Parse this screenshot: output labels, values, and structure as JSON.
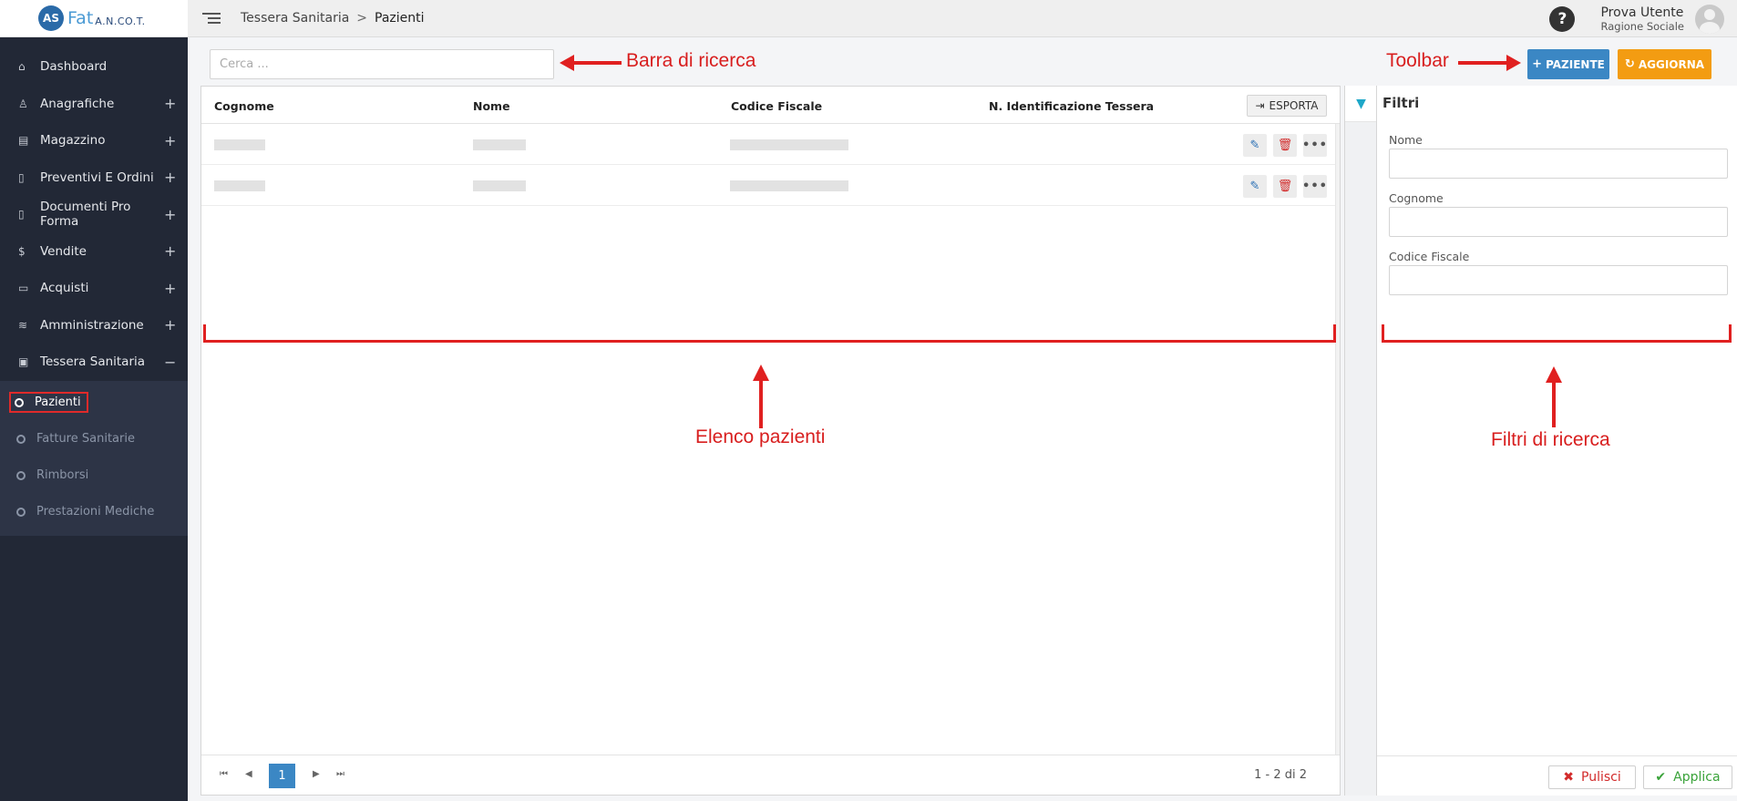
{
  "app": {
    "logo_mark": "AS",
    "logo_text": "Fat",
    "logo_sub": "A.N.CO.T."
  },
  "sidebar": {
    "items": [
      {
        "label": "Dashboard",
        "icon": "home-icon",
        "glyph": "⌂",
        "expand": ""
      },
      {
        "label": "Anagrafiche",
        "icon": "user-icon",
        "glyph": "♙",
        "expand": "+"
      },
      {
        "label": "Magazzino",
        "icon": "list-icon",
        "glyph": "▤",
        "expand": "+"
      },
      {
        "label": "Preventivi E Ordini",
        "icon": "document-icon",
        "glyph": "▯",
        "expand": "+"
      },
      {
        "label": "Documenti Pro Forma",
        "icon": "file-icon",
        "glyph": "▯",
        "expand": "+"
      },
      {
        "label": "Vendite",
        "icon": "dollar-icon",
        "glyph": "$",
        "expand": "+"
      },
      {
        "label": "Acquisti",
        "icon": "credit-card-icon",
        "glyph": "▭",
        "expand": "+"
      },
      {
        "label": "Amministrazione",
        "icon": "database-icon",
        "glyph": "≋",
        "expand": "+"
      },
      {
        "label": "Tessera Sanitaria",
        "icon": "medical-case-icon",
        "glyph": "▣",
        "expand": "−"
      }
    ],
    "subitems": [
      {
        "label": "Pazienti"
      },
      {
        "label": "Fatture Sanitarie"
      },
      {
        "label": "Rimborsi"
      },
      {
        "label": "Prestazioni Mediche"
      }
    ]
  },
  "header": {
    "breadcrumb_parent": "Tessera Sanitaria",
    "breadcrumb_sep": ">",
    "breadcrumb_current": "Pazienti",
    "help": "?",
    "user_name": "Prova Utente",
    "user_company": "Ragione Sociale"
  },
  "search": {
    "placeholder": "Cerca ...",
    "value": ""
  },
  "toolbar": {
    "add_label": "PAZIENTE",
    "add_icon": "+",
    "refresh_label": "AGGIORNA",
    "refresh_icon": "↻"
  },
  "table": {
    "columns": [
      "Cognome",
      "Nome",
      "Codice Fiscale",
      "N. Identificazione Tessera"
    ],
    "export_label": "ESPORTA",
    "export_icon": "⇥",
    "row_action_edit": "✎",
    "row_action_delete": "🗑",
    "row_action_more": "•••",
    "rows": [
      {},
      {}
    ]
  },
  "pagination": {
    "first": "⏮",
    "prev": "◀",
    "current": "1",
    "next": "▶",
    "last": "⏭",
    "info": "1 - 2 di 2"
  },
  "filters": {
    "tab_icon": "▼",
    "title": "Filtri",
    "fields": [
      {
        "label": "Nome",
        "value": ""
      },
      {
        "label": "Cognome",
        "value": ""
      },
      {
        "label": "Codice Fiscale",
        "value": ""
      }
    ],
    "clear_label": "Pulisci",
    "clear_icon": "✖",
    "apply_label": "Applica",
    "apply_icon": "✔"
  },
  "annotations": {
    "search_bar": "Barra di ricerca",
    "toolbar": "Toolbar",
    "patient_list": "Elenco pazienti",
    "search_filters": "Filtri di ricerca"
  },
  "colors": {
    "sidebar_bg": "#222836",
    "primary": "#3b87c4",
    "warning": "#f39c12",
    "annotation_red": "#e02020"
  }
}
